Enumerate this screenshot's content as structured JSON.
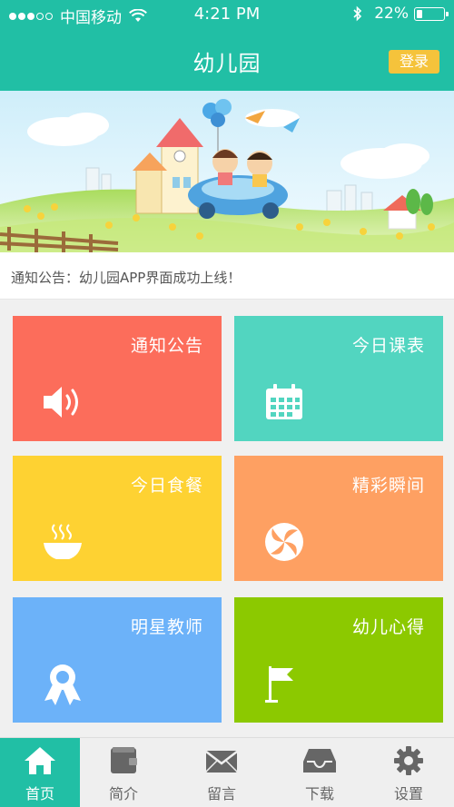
{
  "status_bar": {
    "carrier": "中国移动",
    "time": "4:21 PM",
    "battery": "22%",
    "battery_level": 0.22
  },
  "header": {
    "title": "幼儿园",
    "login_label": "登录"
  },
  "notice": {
    "text": "通知公告：幼儿园APP界面成功上线！"
  },
  "tiles": [
    {
      "label": "通知公告",
      "icon": "speaker-icon",
      "color": "#fc6d5b"
    },
    {
      "label": "今日课表",
      "icon": "calendar-icon",
      "color": "#52d5c0"
    },
    {
      "label": "今日食餐",
      "icon": "bowl-icon",
      "color": "#fed232"
    },
    {
      "label": "精彩瞬间",
      "icon": "candy-icon",
      "color": "#fea062"
    },
    {
      "label": "明星教师",
      "icon": "award-icon",
      "color": "#6cb2f9"
    },
    {
      "label": "幼儿心得",
      "icon": "flag-icon",
      "color": "#8cc900"
    }
  ],
  "tabbar": [
    {
      "label": "首页",
      "icon": "home-icon",
      "active": true
    },
    {
      "label": "简介",
      "icon": "wallet-icon",
      "active": false
    },
    {
      "label": "留言",
      "icon": "mail-icon",
      "active": false
    },
    {
      "label": "下载",
      "icon": "inbox-icon",
      "active": false
    },
    {
      "label": "设置",
      "icon": "gear-icon",
      "active": false
    }
  ],
  "colors": {
    "primary": "#21bfa5",
    "login": "#f5c33b",
    "background": "#f0f0f0"
  }
}
